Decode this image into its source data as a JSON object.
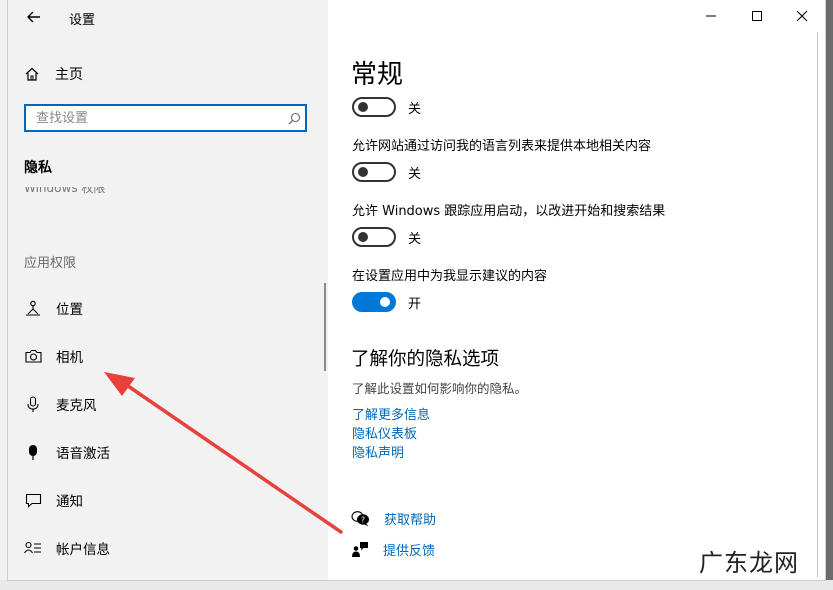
{
  "window": {
    "title": "设置"
  },
  "sidebar": {
    "home_label": "主页",
    "search_placeholder": "查找设置",
    "section_heading": "隐私",
    "cutoff_item": "Windows 权限",
    "permissions_heading": "应用权限",
    "items": [
      {
        "label": "位置",
        "icon": "location-icon"
      },
      {
        "label": "相机",
        "icon": "camera-icon"
      },
      {
        "label": "麦克风",
        "icon": "microphone-icon"
      },
      {
        "label": "语音激活",
        "icon": "voice-activation-icon"
      },
      {
        "label": "通知",
        "icon": "notification-icon"
      },
      {
        "label": "帐户信息",
        "icon": "account-info-icon"
      }
    ]
  },
  "main": {
    "title": "常规",
    "toggles": [
      {
        "description": "",
        "state": "关",
        "on": false
      },
      {
        "description": "允许网站通过访问我的语言列表来提供本地相关内容",
        "state": "关",
        "on": false
      },
      {
        "description": "允许 Windows 跟踪应用启动，以改进开始和搜索结果",
        "state": "关",
        "on": false
      },
      {
        "description": "在设置应用中为我显示建议的内容",
        "state": "开",
        "on": true
      }
    ],
    "privacy_section": {
      "heading": "了解你的隐私选项",
      "subtext": "了解此设置如何影响你的隐私。",
      "links": [
        "了解更多信息",
        "隐私仪表板",
        "隐私声明"
      ]
    },
    "help": {
      "get_help": "获取帮助",
      "feedback": "提供反馈"
    }
  },
  "watermark": "广东龙网",
  "colors": {
    "accent": "#0078d7",
    "link": "#0067b8",
    "arrow": "#e8403a"
  }
}
